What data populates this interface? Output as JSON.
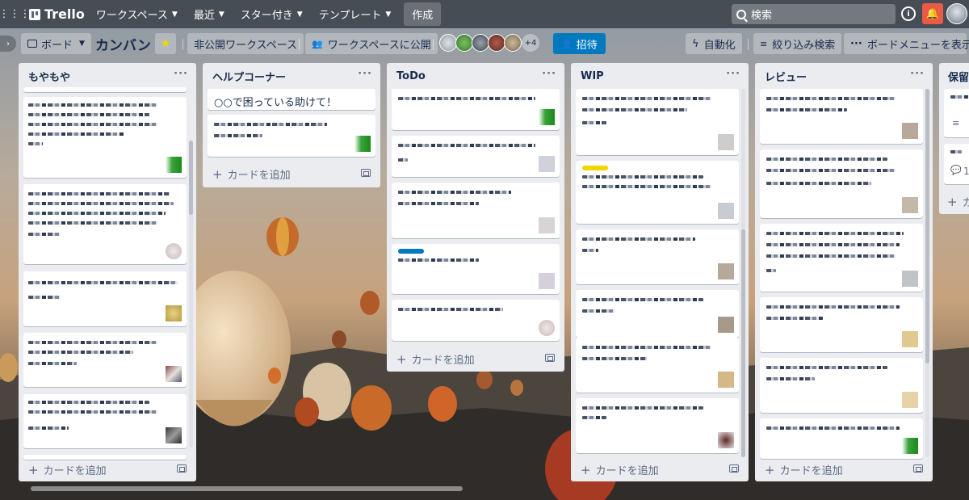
{
  "topnav": {
    "logo": "Trello",
    "menus": [
      "ワークスペース",
      "最近",
      "スター付き",
      "テンプレート"
    ],
    "create": "作成",
    "search_placeholder": "検索",
    "bell_icon": "bell-icon"
  },
  "board": {
    "view_label": "ボード",
    "title": "カンバン",
    "workspace_visibility": "非公開ワークスペース",
    "public_label": "ワークスペースに公開",
    "members_more": "+4",
    "invite": "招待",
    "automation": "自動化",
    "filter": "絞り込み検索",
    "menu": "ボードメニューを表示"
  },
  "lists": [
    {
      "title": "もやもや",
      "add_card": "カードを追加"
    },
    {
      "title": "ヘルプコーナー",
      "add_card": "カードを追加",
      "cards": [
        "○○で困っている助けて！"
      ]
    },
    {
      "title": "ToDo",
      "add_card": "カードを追加"
    },
    {
      "title": "WIP",
      "add_card": "カードを追加"
    },
    {
      "title": "レビュー",
      "add_card": "カードを追加"
    },
    {
      "title": "保留",
      "add_card": "カードを追加",
      "comment_count": "1"
    }
  ],
  "colors": {
    "invite_bg": "#0079bf",
    "bell_bg": "#eb5a46",
    "star": "#f2d600",
    "label_blue": "#0079bf",
    "label_yellow": "#f2d600",
    "list_bg": "#ebecf0"
  }
}
